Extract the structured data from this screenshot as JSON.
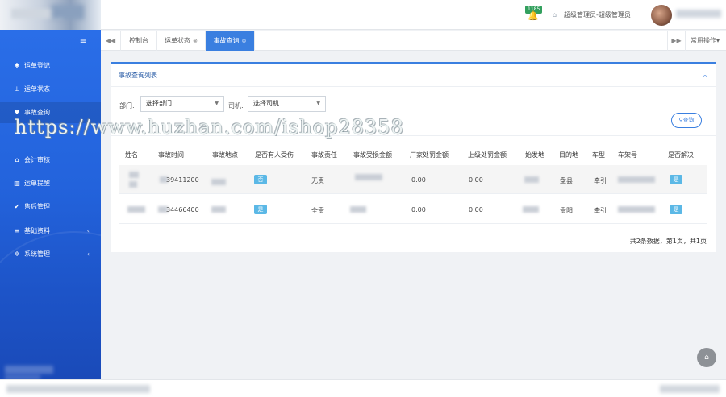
{
  "header": {
    "notification_count": "1185",
    "user_info": "超级管理员-超级管理员"
  },
  "sidebar": {
    "items": [
      {
        "label": "运单登记",
        "icon": "paw-icon"
      },
      {
        "label": "运单状态",
        "icon": "sitemap-icon"
      },
      {
        "label": "事故查询",
        "icon": "heart-icon",
        "active": true
      },
      {
        "label": "会计审核",
        "icon": "bank-icon"
      },
      {
        "label": "运单提醒",
        "icon": "chart-icon"
      },
      {
        "label": "售后管理",
        "icon": "thumbs-up-icon"
      },
      {
        "label": "基础资料",
        "icon": "list-icon",
        "has_children": true
      },
      {
        "label": "系统管理",
        "icon": "gear-icon",
        "has_children": true
      }
    ]
  },
  "tabs": [
    {
      "label": "控制台",
      "closable": false
    },
    {
      "label": "运单状态",
      "closable": true
    },
    {
      "label": "事故查询",
      "closable": true,
      "active": true
    }
  ],
  "tab_ops_label": "常用操作▾",
  "panel": {
    "title": "事故查询列表",
    "filters": {
      "dept_label": "部门:",
      "dept_value": "选择部门",
      "driver_label": "司机:",
      "driver_value": "选择司机"
    },
    "search_label": "查询",
    "columns": [
      "姓名",
      "事故时间",
      "事故地点",
      "是否有人受伤",
      "事故责任",
      "事故受损金额",
      "厂家处罚金额",
      "上级处罚金额",
      "始发地",
      "目的地",
      "车型",
      "车架号",
      "是否解决"
    ],
    "rows": [
      {
        "time": "39411200",
        "injured": "否",
        "liability": "无责",
        "factory_penalty": "0.00",
        "superior_penalty": "0.00",
        "destination": "盘县",
        "vehicle_type": "牵引",
        "resolved": "是"
      },
      {
        "time": "34466400",
        "injured": "是",
        "liability": "全责",
        "factory_penalty": "0.00",
        "superior_penalty": "0.00",
        "destination": "贵阳",
        "vehicle_type": "牵引",
        "resolved": "是"
      }
    ],
    "pagination": "共2条数据，第1页，共1页"
  },
  "watermark": "https://www.huzhan.com/ishop28358",
  "colors": {
    "accent": "#3a7fe0",
    "sidebar": "#2363dc",
    "badge": "#5bb8e6",
    "notification": "#33a05e"
  }
}
